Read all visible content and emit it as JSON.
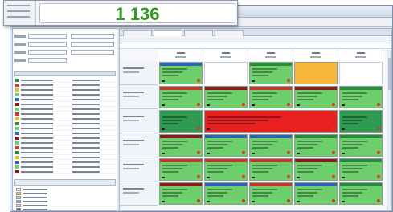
{
  "popup": {
    "value": "1 136",
    "value_color": "#2e9a1e"
  },
  "colors": {
    "green": "#6ccf6c",
    "dark_green": "#2f9a52",
    "red": "#e82020",
    "orange": "#f7b73a",
    "white": "#ffffff",
    "header_red": "#c0392b",
    "header_darkred": "#8b1a1a",
    "header_blue": "#2f63b5",
    "header_green": "#2a8a3e"
  },
  "list_swatches": [
    "#2a8a3e",
    "#d13a2a",
    "#e0c020",
    "#6ccf6c",
    "#2f63b5",
    "#8b1a1a",
    "#6ccf6c",
    "#c0392b",
    "#e0c020",
    "#2a8a3e",
    "#6ccf6c",
    "#2f63b5",
    "#8b1a1a",
    "#6ccf6c",
    "#d13a2a",
    "#2a8a3e",
    "#e0c020",
    "#2f63b5",
    "#6ccf6c",
    "#8b1a1a"
  ],
  "legend_swatches": [
    "#ffffff",
    "#f7d37a",
    "#b9d4f2",
    "#7a9fd6",
    "#e7b9e6",
    "#3b3f8a"
  ]
}
